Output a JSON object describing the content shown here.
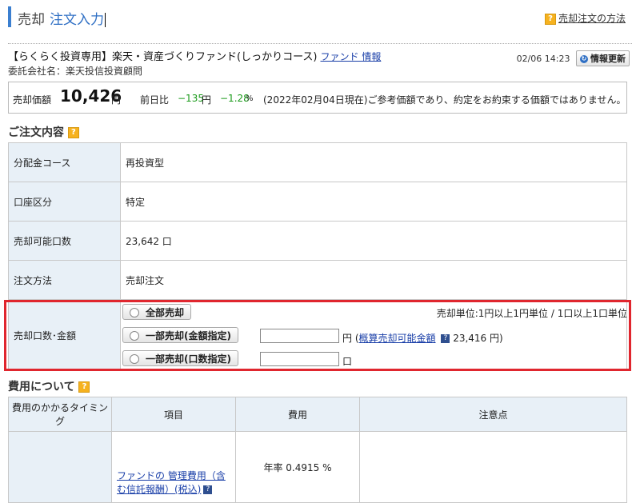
{
  "header": {
    "title_prefix": "売却",
    "title_main": "注文入力",
    "help_link": "売却注文の方法"
  },
  "fund": {
    "name": "【らくらく投資専用】楽天・資産づくりファンド(しっかりコース)",
    "info_link": "ファンド 情報",
    "company": "委託会社名：楽天投信投資顧問",
    "datetime": "02/06 14:23",
    "refresh_label": "情報更新"
  },
  "price": {
    "label": "売却価額",
    "value": "10,426",
    "unit": "円",
    "prev_label": "前日比",
    "change": "−135",
    "change_unit": "円",
    "change_pct": "−1.28",
    "pct_unit": "%",
    "note": "(2022年02月04日現在)ご参考価額であり、約定をお約束する価額ではありません。"
  },
  "order": {
    "section_title": "ご注文内容",
    "rows": [
      {
        "label": "分配金コース",
        "value": "再投資型"
      },
      {
        "label": "口座区分",
        "value": "特定"
      },
      {
        "label": "売却可能口数",
        "value": "23,642 口"
      },
      {
        "label": "注文方法",
        "value": "売却注文"
      }
    ],
    "qty_label": "売却口数･金額",
    "option_all": "全部売却",
    "option_amount": "一部売却(金額指定)",
    "option_units": "一部売却(口数指定)",
    "unit_note": "売却単位:1円以上1円単位 / 1口以上1口単位",
    "amount_unit": "円",
    "estimate_open": "(",
    "estimate_link": "概算売却可能金額",
    "estimate_value": "23,416 円)",
    "units_unit": "口"
  },
  "fees": {
    "section_title": "費用について",
    "headers": [
      "費用のかかるタイミング",
      "項目",
      "費用",
      "注意点"
    ],
    "row": {
      "timing": "",
      "item_link": "ファンドの 管理費用（含む信託報酬）(税込)",
      "cost": "年率 0.4915 %",
      "note": ""
    }
  },
  "colors": {
    "accent": "#2f6fc4",
    "highlight_border": "#e0262e",
    "label_bg": "#e8f0f7",
    "positive_change": "#1a9a1a"
  }
}
